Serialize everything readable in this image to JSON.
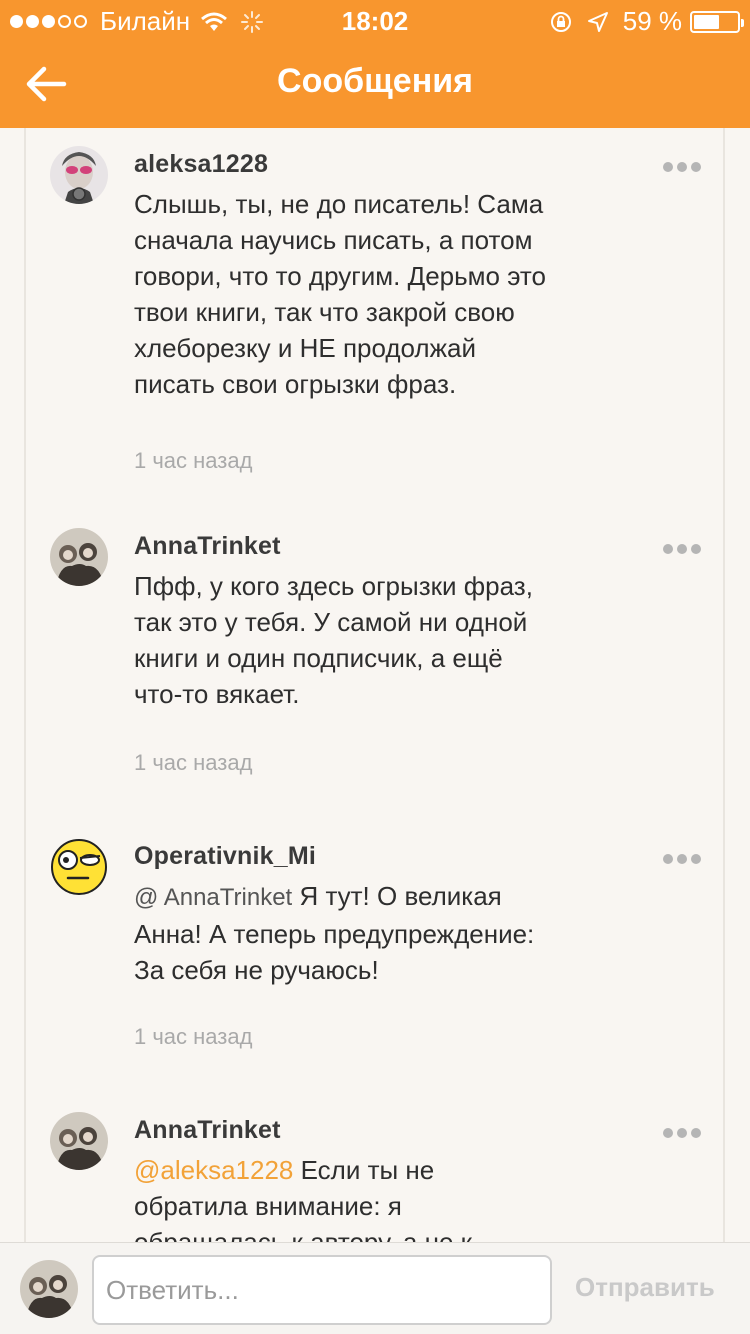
{
  "status_bar": {
    "carrier": "Билайн",
    "time": "18:02",
    "battery": "59 %",
    "battery_level": 0.59
  },
  "header": {
    "title": "Сообщения",
    "back_icon": "back-arrow-icon"
  },
  "comments": [
    {
      "username": "aleksa1228",
      "text": "Слышь, ты, не до писатель! Сама сначала научись писать, а потом говори, что то другим. Дерьмо это твои книги, так что закрой свою хлеборезку и НЕ продолжай писать свои огрызки фраз.",
      "time": "1 час назад"
    },
    {
      "username": "AnnaTrinket",
      "text": "Пфф, у кого здесь огрызки фраз, так это у тебя. У самой ни одной книги и один подписчик, а ещё что-то вякает.",
      "time": "1 час назад"
    },
    {
      "username": "Operativnik_Mi",
      "mention": "@ AnnaTrinket",
      "text": " Я тут! О великая Анна! А теперь предупреждение: За себя не ручаюсь!",
      "time": "1 час назад"
    },
    {
      "username": "AnnaTrinket",
      "mention": "@aleksa1228",
      "text": " Если ты не обратила внимание: я обращалась к автору, а не к"
    }
  ],
  "reply_bar": {
    "placeholder": "Ответить...",
    "send_label": "Отправить"
  },
  "colors": {
    "accent": "#f8962e",
    "mention": "#f2a238",
    "background": "#f9f6f2"
  }
}
